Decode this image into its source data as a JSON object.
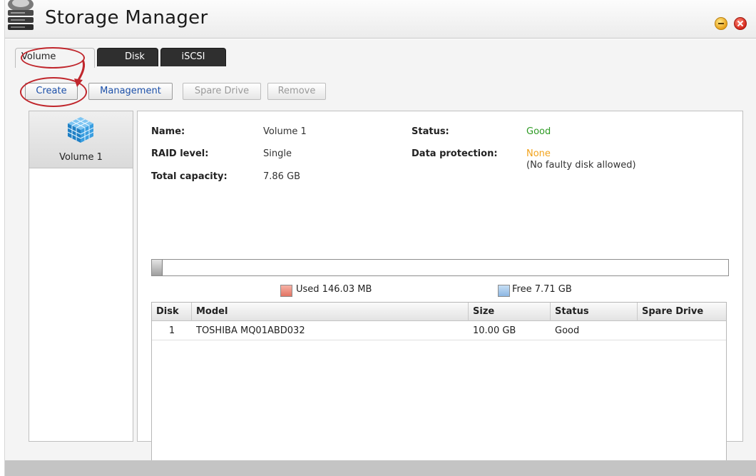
{
  "window": {
    "title": "Storage Manager"
  },
  "tabs": [
    {
      "label": "Volume",
      "active": true
    },
    {
      "label": "Disk",
      "active": false
    },
    {
      "label": "iSCSI",
      "active": false
    }
  ],
  "toolbar": {
    "create": "Create",
    "management": "Management",
    "spare_drive": "Spare Drive",
    "remove": "Remove"
  },
  "volumes": [
    {
      "label": "Volume 1"
    }
  ],
  "details": {
    "name_label": "Name:",
    "name_value": "Volume 1",
    "raid_label": "RAID level:",
    "raid_value": "Single",
    "capacity_label": "Total capacity:",
    "capacity_value": "7.86 GB",
    "status_label": "Status:",
    "status_value": "Good",
    "protection_label": "Data protection:",
    "protection_value": "None",
    "protection_note": "(No faulty disk allowed)"
  },
  "usage": {
    "used_label": "Used 146.03 MB",
    "free_label": "Free 7.71 GB",
    "used_fraction": 0.018
  },
  "colors": {
    "good": "#2e9a24",
    "none": "#f2a31b",
    "link": "#1b4fa8",
    "annotation": "#c0262c"
  },
  "disk_table": {
    "headers": [
      "Disk",
      "Model",
      "Size",
      "Status",
      "Spare Drive"
    ],
    "rows": [
      {
        "disk": "1",
        "model": "TOSHIBA MQ01ABD032",
        "size": "10.00 GB",
        "status": "Good",
        "spare": ""
      }
    ]
  }
}
